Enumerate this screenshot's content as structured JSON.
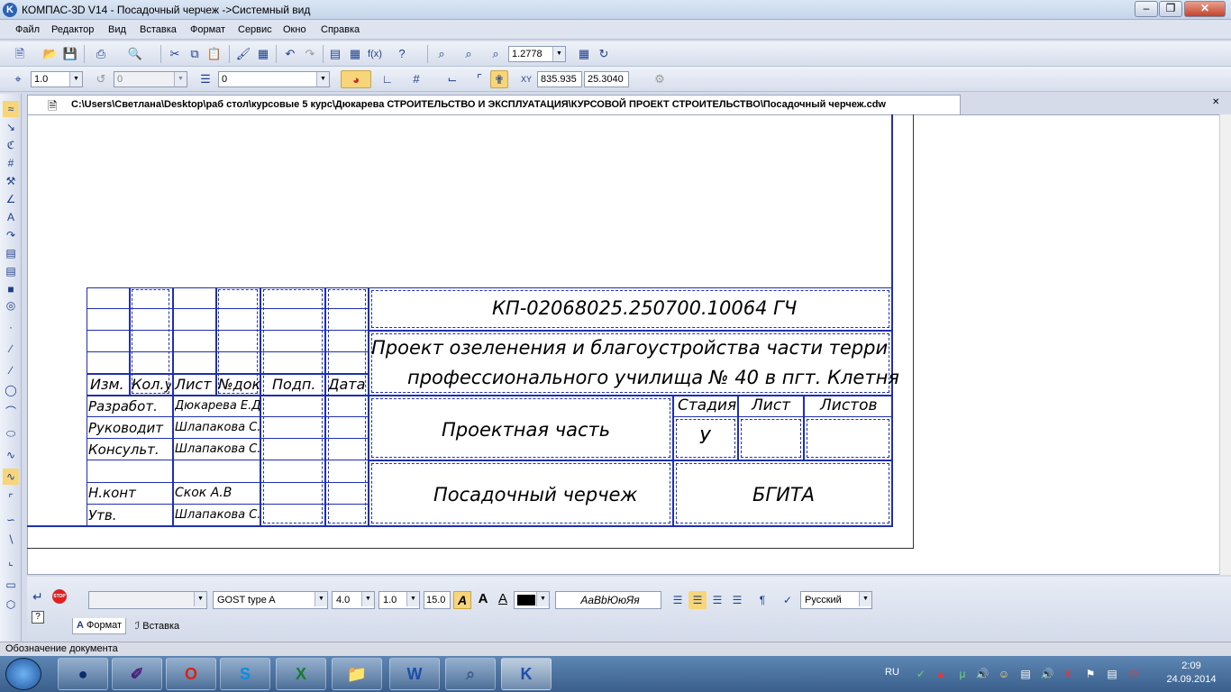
{
  "window": {
    "title": "КОМПАС-3D V14 - Посадочный черчеж ->Системный вид",
    "icon": "kompas-logo"
  },
  "menu": [
    "Файл",
    "Редактор",
    "Вид",
    "Вставка",
    "Формат",
    "Сервис",
    "Окно",
    "Справка"
  ],
  "toolbar1": {
    "zoom": "1.2778"
  },
  "toolbar2": {
    "step": "1.0",
    "angle": "0",
    "layer": "0",
    "x": "835.935",
    "y": "25.3040"
  },
  "doc_tab": {
    "path": "C:\\Users\\Светлана\\Desktop\\раб стол\\курсовые 5 курс\\Дюкарева СТРОИТЕЛЬСТВО И ЭКСПЛУАТАЦИЯ\\КУРСОВОЙ ПРОЕКТ СТРОИТЕЛЬСТВО\\Посадочный черчеж.cdw"
  },
  "stamp": {
    "code": "КП-02068025.250700.10064 ГЧ",
    "project_line1": "Проект озеленения и благоустройства части территории",
    "project_line2": "профессионального училища № 40 в пгт. Клетня",
    "section": "Проектная часть",
    "drawing": "Посадочный черчеж",
    "org": "БГИТА",
    "stage_label": "Стадия",
    "sheet_label": "Лист",
    "sheets_label": "Листов",
    "stage_value": "У",
    "headers": [
      "Изм.",
      "Кол.уч",
      "Лист",
      "№док",
      "Подп.",
      "Дата"
    ],
    "roles": [
      {
        "role": "Разработ.",
        "name": "Дюкарева Е.Д."
      },
      {
        "role": "Руководит",
        "name": "Шлапакова С.Н."
      },
      {
        "role": "Консульт.",
        "name": "Шлапакова С.Н."
      },
      {
        "role": "",
        "name": ""
      },
      {
        "role": "Н.конт",
        "name": "Скок А.В"
      },
      {
        "role": "Утв.",
        "name": "Шлапакова С.Н."
      }
    ]
  },
  "props": {
    "font": "GOST type A",
    "height": "4.0",
    "stretch": "1.0",
    "angle": "15.0",
    "sample": "АаВbЮюЯя",
    "language": "Русский",
    "tab_format": "Формат",
    "tab_insert": "Вставка"
  },
  "status": "Обозначение документа",
  "taskbar": {
    "lang": "RU",
    "time": "2:09",
    "date": "24.09.2014"
  }
}
